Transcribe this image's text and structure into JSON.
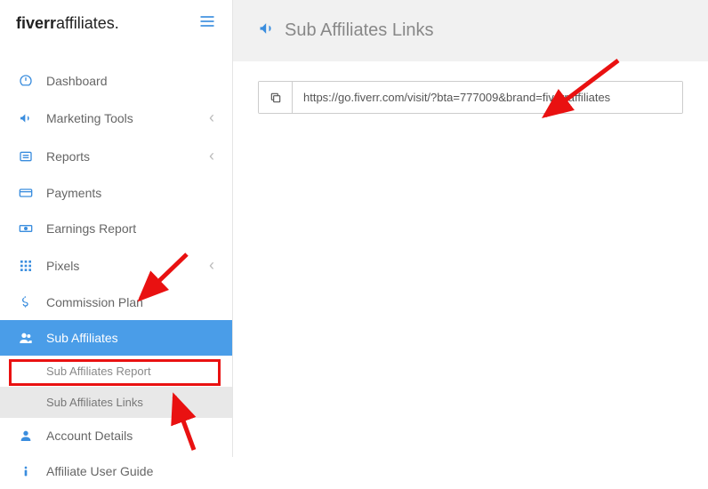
{
  "header": {
    "logo_main": "fiverr",
    "logo_sub": "affiliates."
  },
  "nav": {
    "items": [
      {
        "label": "Dashboard"
      },
      {
        "label": "Marketing Tools"
      },
      {
        "label": "Reports"
      },
      {
        "label": "Payments"
      },
      {
        "label": "Earnings Report"
      },
      {
        "label": "Pixels"
      },
      {
        "label": "Commission Plan"
      },
      {
        "label": "Sub Affiliates"
      },
      {
        "label": "Account Details"
      },
      {
        "label": "Affiliate User Guide"
      }
    ],
    "sub_items": [
      {
        "label": "Sub Affiliates Report"
      },
      {
        "label": "Sub Affiliates Links"
      }
    ]
  },
  "page": {
    "title": "Sub Affiliates Links"
  },
  "url_box": {
    "value": "https://go.fiverr.com/visit/?bta=777009&brand=fiverraffiliates"
  }
}
